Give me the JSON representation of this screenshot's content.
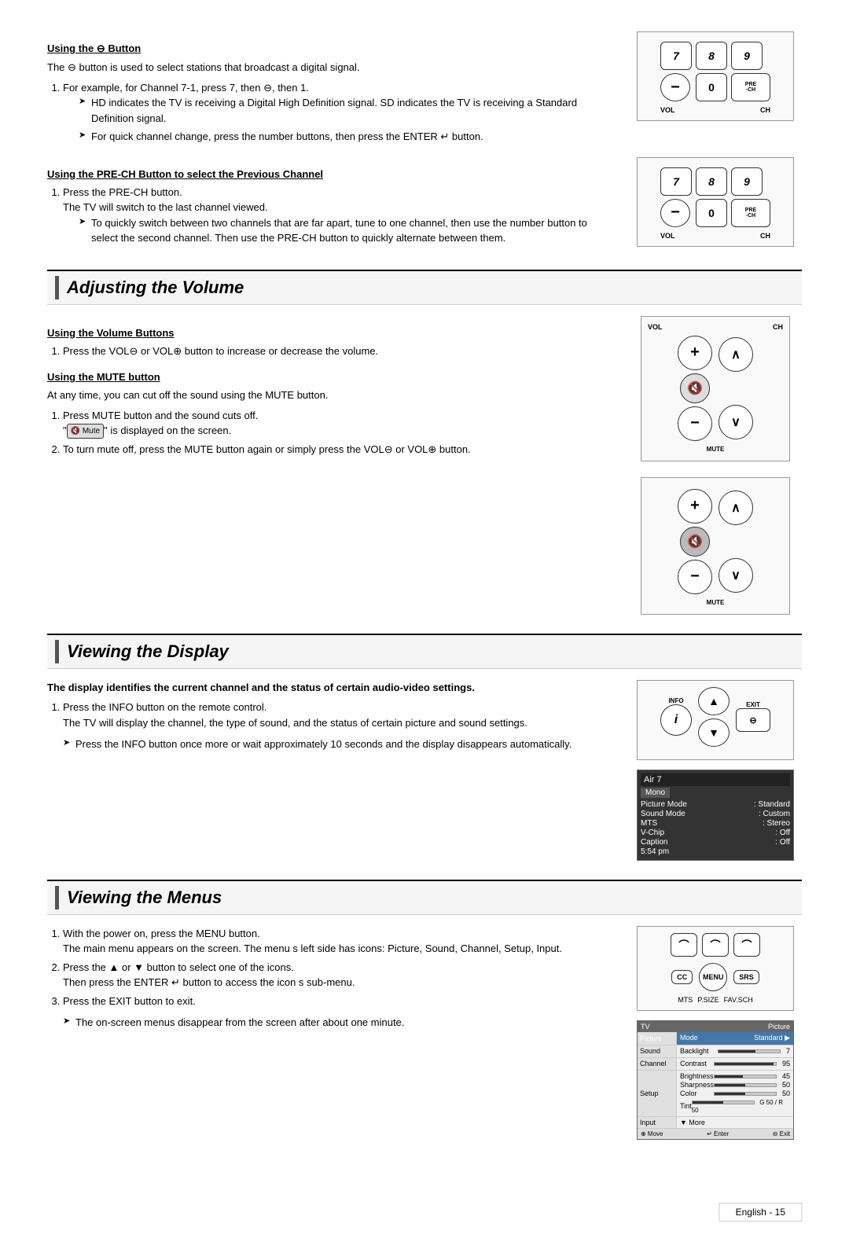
{
  "page": {
    "footer": "English - 15"
  },
  "sections": {
    "channel": {
      "subsections": [
        {
          "title": "Using the ⊖ Button",
          "intro": "The ⊖ button is used to select stations that broadcast a digital signal.",
          "steps": [
            {
              "text": "For example, for Channel 7-1, press 7, then ⊖, then 1.",
              "notes": [
                "HD indicates the TV is receiving a Digital High Definition signal. SD indicates the TV is receiving a Standard Definition signal.",
                "For quick channel change, press the number buttons, then press the ENTER ↵ button."
              ]
            }
          ]
        },
        {
          "title": "Using the PRE-CH Button to select the Previous Channel",
          "steps": [
            {
              "text": "Press the PRE-CH button.",
              "sub": "The TV will switch to the last channel viewed.",
              "notes": [
                "To quickly switch between two channels that are far apart, tune to one channel, then use the number button to select the second channel. Then use the PRE-CH button to quickly alternate between them."
              ]
            }
          ]
        }
      ]
    },
    "volume": {
      "title": "Adjusting the Volume",
      "subsections": [
        {
          "title": "Using the Volume Buttons",
          "steps": [
            {
              "text": "Press the VOL⊖ or VOL⊕ button to increase or decrease the volume."
            }
          ]
        },
        {
          "title": "Using the MUTE button",
          "intro": "At any time, you can cut off the sound using the MUTE button.",
          "steps": [
            {
              "text": "Press MUTE button and the sound cuts off.",
              "sub": "\" 🔇 Mute \" is displayed on the screen."
            },
            {
              "text": "To turn mute off, press the MUTE button again or simply press the VOL⊖ or VOL⊕ button."
            }
          ]
        }
      ]
    },
    "display": {
      "title": "Viewing the Display",
      "intro": "The display identifies the current channel and the status of certain audio-video settings.",
      "steps": [
        {
          "text": "Press the INFO button on the remote control.",
          "sub": "The TV will display the channel, the type of sound, and the status of certain picture and sound settings."
        }
      ],
      "notes": [
        "Press the INFO button once more or wait approximately 10 seconds and the display disappears automatically."
      ],
      "osd": {
        "channel": "Air 7",
        "mode": "Mono",
        "rows": [
          {
            "label": "Picture Mode",
            "value": ": Standard"
          },
          {
            "label": "Sound Mode",
            "value": ": Custom"
          },
          {
            "label": "MTS",
            "value": ": Stereo"
          },
          {
            "label": "V-Chip",
            "value": ": Off"
          },
          {
            "label": "Caption",
            "value": ": Off"
          },
          {
            "label": "5:54 pm",
            "value": ""
          }
        ]
      }
    },
    "menus": {
      "title": "Viewing the Menus",
      "steps": [
        {
          "text": "With the power on, press the MENU button.",
          "sub": "The main menu appears on the screen. The menu s left side has icons: Picture, Sound, Channel, Setup, Input."
        },
        {
          "text": "Press the ▲ or ▼ button to select one of the icons.",
          "sub": "Then press the ENTER ↵ button to access the icon s sub-menu."
        },
        {
          "text": "Press the EXIT button to exit."
        }
      ],
      "notes": [
        "The on-screen menus disappear from the screen after about one minute."
      ],
      "picture_menu": {
        "header_left": "TV",
        "header_right": "Picture",
        "sidebar_items": [
          "Picture",
          "Sound",
          "Channel",
          "Setup",
          "Input"
        ],
        "content_rows": [
          {
            "label": "Mode",
            "value": "Standard",
            "has_bar": false,
            "highlighted": true
          },
          {
            "label": "Backlight",
            "value": "7",
            "has_bar": true,
            "fill": 60
          },
          {
            "label": "Contrast",
            "value": "95",
            "has_bar": true,
            "fill": 95
          },
          {
            "label": "Brightness",
            "value": "45",
            "has_bar": true,
            "fill": 45
          },
          {
            "label": "Sharpness",
            "value": "50",
            "has_bar": true,
            "fill": 50
          },
          {
            "label": "Color",
            "value": "50",
            "has_bar": true,
            "fill": 50
          },
          {
            "label": "Tint",
            "value": "G50 / R50",
            "has_bar": true,
            "fill": 50
          }
        ],
        "more": "▼ More",
        "footer": [
          "⊕ Move",
          "↵ Enter",
          "⊖ Exit"
        ]
      }
    }
  }
}
